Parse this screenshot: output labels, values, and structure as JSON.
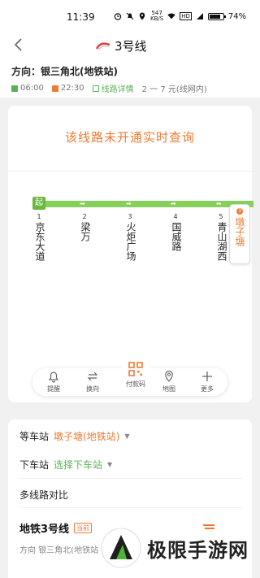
{
  "status": {
    "time": "11:39",
    "speed_top": "547",
    "speed_bottom": "KB/S",
    "hd": "HD",
    "battery": "74%"
  },
  "header": {
    "title": "3号线"
  },
  "info": {
    "direction": "方向：银三角北(地铁站)",
    "first_bus": "06:00",
    "last_bus": "22:30",
    "details_link": "线路详情",
    "fare": "2 一 7 元(线网内)"
  },
  "map": {
    "notice": "该线路未开通实时查询",
    "start_tag": "起",
    "stops": [
      {
        "num": "1",
        "name": "京东大道"
      },
      {
        "num": "2",
        "name": "梁万"
      },
      {
        "num": "3",
        "name": "火炬广场"
      },
      {
        "num": "4",
        "name": "国威路"
      },
      {
        "num": "5",
        "name": "青山湖西"
      }
    ],
    "current": {
      "badge": "3",
      "name": "墩子塘"
    },
    "colors": {
      "line": "#86d05a",
      "accent": "#f07a32"
    }
  },
  "toolbar": {
    "remind": "提醒",
    "reverse": "换向",
    "pay": "付款码",
    "map": "地图",
    "more": "更多"
  },
  "panel": {
    "wait_label": "等车站",
    "wait_value": "墩子塘(地铁站)",
    "alight_label": "下车站",
    "alight_value": "选择下车站",
    "compare": "多线路对比",
    "line_title": "地铁3号线",
    "line_badge": "当前",
    "line_dir": "方向 银三角北(地铁站"
  },
  "watermark": {
    "text": "极限手游网"
  }
}
